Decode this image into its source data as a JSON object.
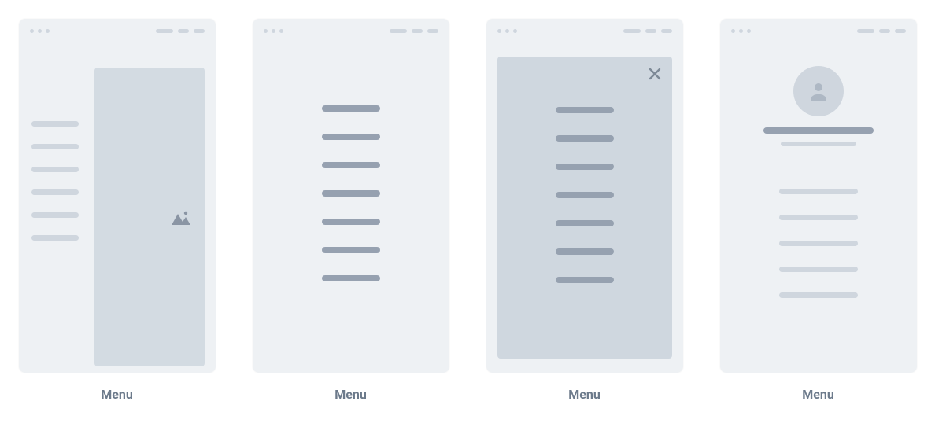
{
  "variants": [
    {
      "caption": "Menu",
      "type": "side-drawer"
    },
    {
      "caption": "Menu",
      "type": "fullscreen-list"
    },
    {
      "caption": "Menu",
      "type": "overlay-modal"
    },
    {
      "caption": "Menu",
      "type": "profile-menu"
    }
  ],
  "wireframe": {
    "side_menu_item_count": 6,
    "center_menu_item_count": 7,
    "overlay_menu_item_count": 7,
    "profile_menu_item_count": 5
  }
}
